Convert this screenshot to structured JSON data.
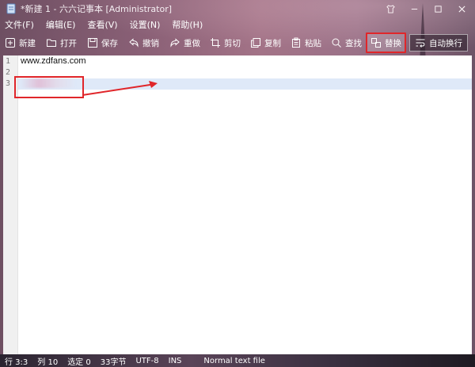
{
  "titlebar": {
    "title": "*新建 1 - 六六记事本 [Administrator]"
  },
  "menu": [
    "文件(F)",
    "编辑(E)",
    "查看(V)",
    "设置(N)",
    "帮助(H)"
  ],
  "toolbar": {
    "new": "新建",
    "open": "打开",
    "save": "保存",
    "undo": "撤销",
    "redo": "重做",
    "cut": "剪切",
    "copy": "复制",
    "paste": "粘贴",
    "find": "查找",
    "replace": "替换",
    "wrap": "自动换行"
  },
  "editor": {
    "lines": [
      "1",
      "2",
      "3"
    ],
    "text": [
      "www.zdfans.com",
      "",
      ""
    ]
  },
  "status": {
    "row": "行 3:3",
    "col": "列 10",
    "sel": "选定 0",
    "bytes": "33字节",
    "encoding": "UTF-8",
    "mode": "INS",
    "syntax": "Normal text file"
  },
  "colors": {
    "accent": "#e0262a",
    "current_line": "#dfe9f8"
  }
}
